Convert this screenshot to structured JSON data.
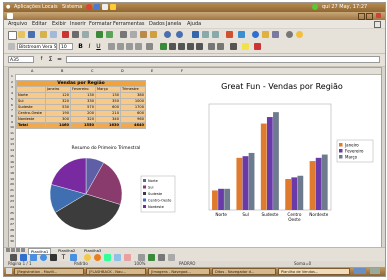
{
  "topbar": {
    "menus": [
      "Aplicações",
      "Locais",
      "Sistema"
    ],
    "clock": "qui 27 May, 17:27"
  },
  "menubar": [
    "Arquivo",
    "Editar",
    "Exibir",
    "Inserir",
    "Formatar",
    "Ferramentas",
    "Dados",
    "Janela",
    "Ajuda"
  ],
  "formatting": {
    "font_name": "Bitstream Vera S",
    "font_size": "10"
  },
  "formula_bar": {
    "cell_ref": "A35",
    "input_value": ""
  },
  "spreadsheet": {
    "title": "Vendas por Região",
    "columns": [
      "A",
      "B",
      "C",
      "D",
      "E",
      "F"
    ],
    "header": [
      "",
      "Janeiro",
      "Fevereiro",
      "Março",
      "Trimestre"
    ],
    "rows": [
      [
        "Norte",
        "120",
        "130",
        "130",
        "380"
      ],
      [
        "Sul",
        "320",
        "330",
        "350",
        "1000"
      ],
      [
        "Sudeste",
        "530",
        "570",
        "600",
        "1700"
      ],
      [
        "Centro-Oeste",
        "190",
        "200",
        "210",
        "600"
      ],
      [
        "Nordeste",
        "300",
        "320",
        "340",
        "960"
      ],
      [
        "Total",
        "1460",
        "1550",
        "1630",
        "4640"
      ]
    ]
  },
  "pie_chart": {
    "title": "Resumo do Primeiro Trimestral",
    "chart_data": {
      "type": "pie",
      "categories": [
        "Norte",
        "Sul",
        "Sudeste",
        "Centro-Oeste",
        "Nordeste"
      ],
      "values": [
        380,
        1000,
        1700,
        600,
        960
      ],
      "colors": [
        "#5f5fa8",
        "#8a3b6e",
        "#3c3c3c",
        "#3f6fb0",
        "#7a2aa0"
      ]
    }
  },
  "bar_chart": {
    "chart_data": {
      "type": "bar",
      "title": "Great Fun - Vendas por Região",
      "categories": [
        "Norte",
        "Sul",
        "Sudeste",
        "Centro-Oeste",
        "Nordeste"
      ],
      "series": [
        {
          "name": "Janeiro",
          "values": [
            120,
            320,
            530,
            190,
            300
          ],
          "color": "#e07a2e"
        },
        {
          "name": "Fevereiro",
          "values": [
            130,
            330,
            570,
            200,
            320
          ],
          "color": "#6a3aa8"
        },
        {
          "name": "Março",
          "values": [
            130,
            350,
            600,
            210,
            340
          ],
          "color": "#6e7a8e"
        }
      ],
      "ylim": [
        0,
        650
      ]
    }
  },
  "sheet_tabs": [
    "Planilha1",
    "Planilha2",
    "Planilha3"
  ],
  "status": {
    "page": "Página 1 / 1",
    "style": "Padrão",
    "zoom": "100%",
    "mode": "PADRÃO",
    "sum": "Soma=0"
  },
  "taskbar": [
    "[Registration - Mozill...",
    "[FLASHBACK - Nau...",
    "[Imagens - Navegad...",
    "Ditos - Navegador d...",
    "Planilha de Vendas..."
  ],
  "colors": {
    "title_bar": "#a07544",
    "sheet_header": "#f0a23c",
    "table_body": "#f7c98b",
    "table_total": "#f2a84e"
  }
}
